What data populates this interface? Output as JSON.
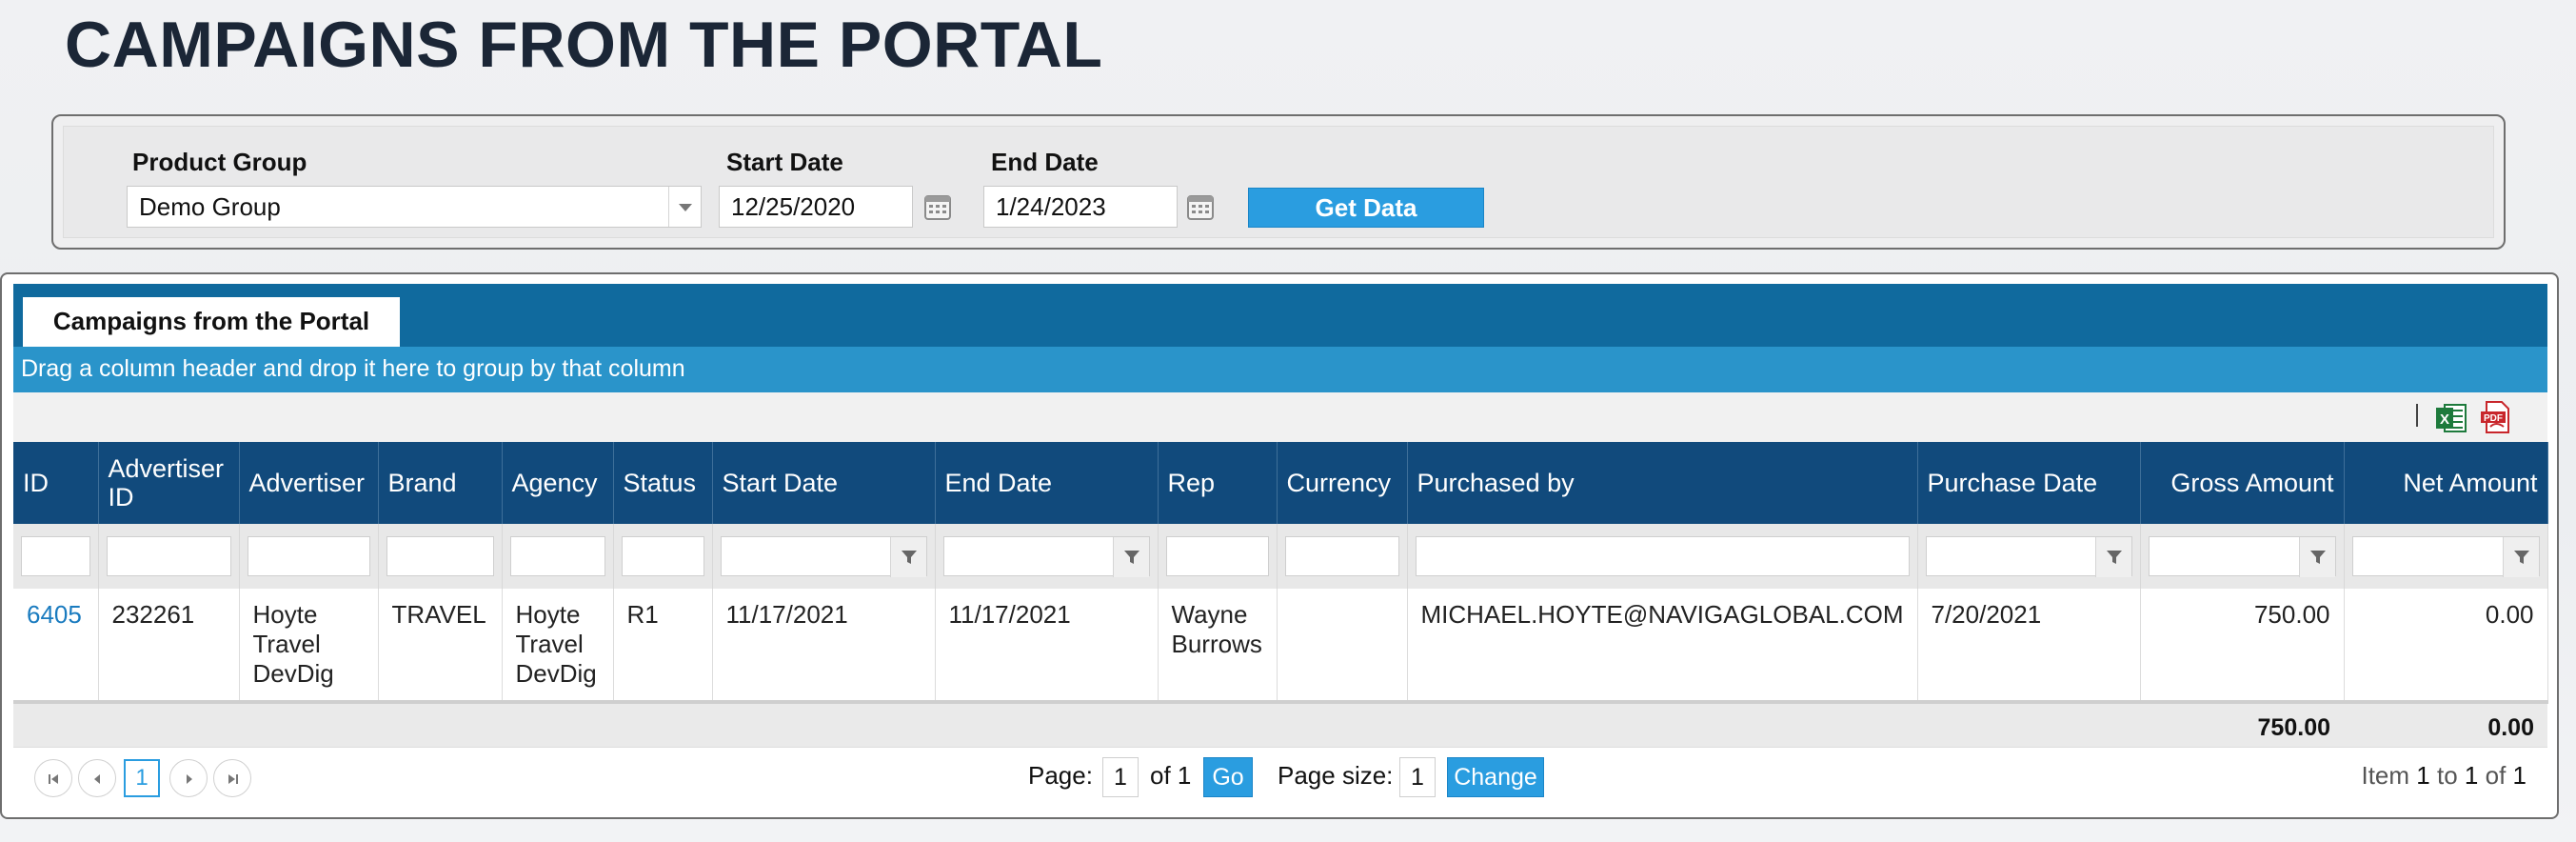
{
  "page": {
    "title": "CAMPAIGNS FROM THE PORTAL"
  },
  "filters": {
    "product_group_label": "Product Group",
    "product_group_value": "Demo Group",
    "start_date_label": "Start Date",
    "start_date_value": "12/25/2020",
    "end_date_label": "End Date",
    "end_date_value": "1/24/2023",
    "get_data_label": "Get Data"
  },
  "grid": {
    "tab_label": "Campaigns from the Portal",
    "group_hint": "Drag a column header and drop it here to group by that column",
    "columns": [
      "ID",
      "Advertiser ID",
      "Advertiser",
      "Brand",
      "Agency",
      "Status",
      "Start Date",
      "End Date",
      "Rep",
      "Currency",
      "Purchased by",
      "Purchase Date",
      "Gross Amount",
      "Net Amount"
    ],
    "rows": [
      {
        "id": "6405",
        "advertiser_id": "232261",
        "advertiser": "Hoyte Travel DevDig",
        "brand": "TRAVEL",
        "agency": "Hoyte Travel DevDig",
        "status": "R1",
        "start_date": "11/17/2021",
        "end_date": "11/17/2021",
        "rep": "Wayne Burrows",
        "currency": "",
        "purchased_by": "MICHAEL.HOYTE@NAVIGAGLOBAL.COM",
        "purchase_date": "7/20/2021",
        "gross_amount": "750.00",
        "net_amount": "0.00"
      }
    ],
    "totals": {
      "gross_amount": "750.00",
      "net_amount": "0.00"
    }
  },
  "pager": {
    "current_page": "1",
    "page_label": "Page:",
    "page_input": "1",
    "of_label": "of 1",
    "go_label": "Go",
    "page_size_label": "Page size:",
    "page_size_input": "1",
    "change_label": "Change",
    "item_label": "Item",
    "item_from": "1",
    "to_label": "to",
    "item_to": "1",
    "of_word": "of",
    "item_total": "1"
  },
  "colors": {
    "header_dark": "#114a7c",
    "tab_strip": "#106a9e",
    "group_hint_bg": "#2a94ca",
    "accent_button": "#2a9de0",
    "link": "#1a7bbf"
  },
  "icons": [
    "dropdown-arrow-icon",
    "calendar-icon",
    "excel-icon",
    "pdf-icon",
    "filter-icon",
    "first-page-icon",
    "prev-page-icon",
    "next-page-icon",
    "last-page-icon"
  ]
}
